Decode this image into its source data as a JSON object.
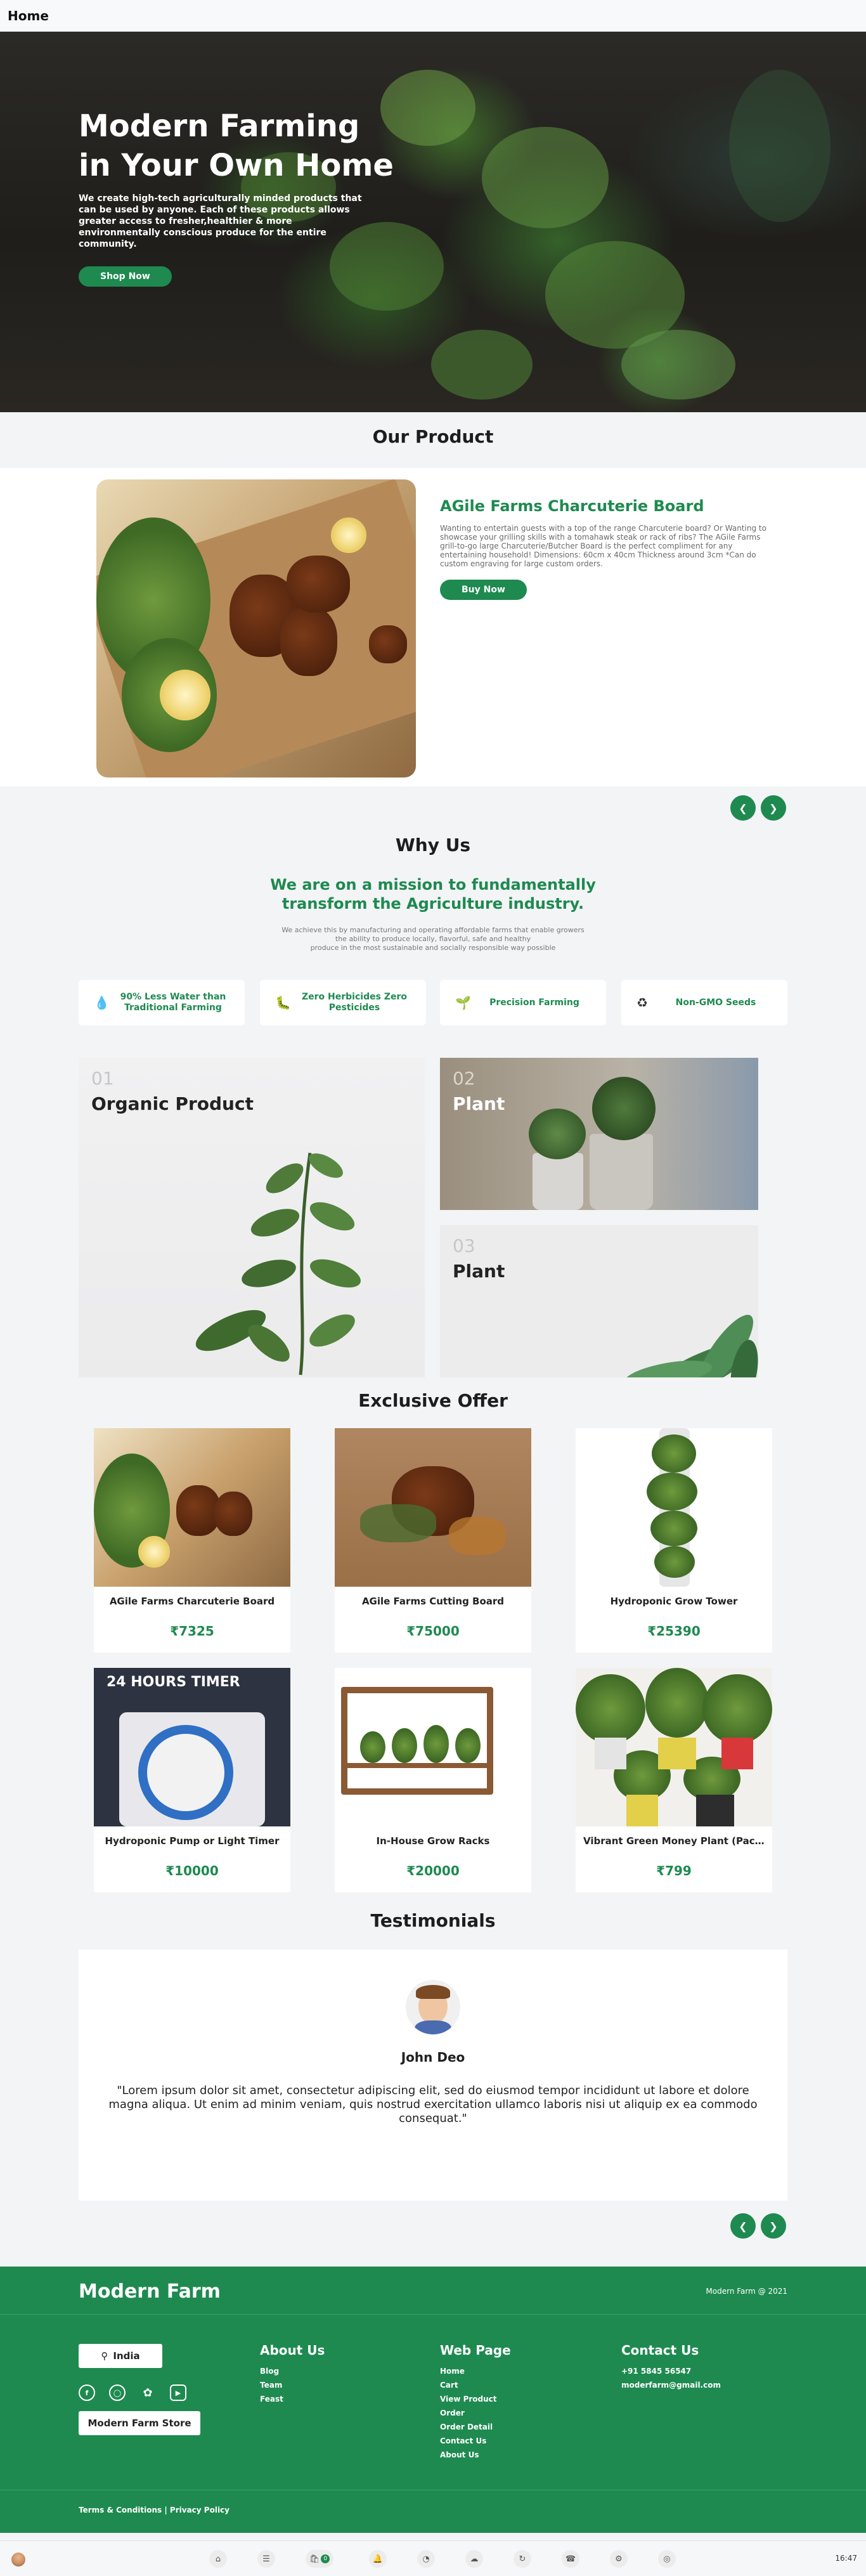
{
  "topbar": {
    "title": "Home"
  },
  "hero": {
    "title_line1": "Modern Farming",
    "title_line2": "in Your Own Home",
    "description": "We create high-tech agriculturally minded products that can be used by anyone. Each of these products allows greater access to fresher,healthier & more environmentally conscious produce for the entire community.",
    "button": "Shop Now"
  },
  "our_product": {
    "heading": "Our Product",
    "title": "AGile Farms Charcuterie Board",
    "description": "Wanting to entertain guests with a top of the range Charcuterie board? Or Wanting to showcase your grilling skills with a tomahawk steak or rack of ribs? The AGile Farms grill-to-go large Charcuterie/Butcher Board is the perfect compliment for any entertaining household! Dimensions: 60cm x 40cm Thickness around 3cm *Can do custom engraving for large custom orders.",
    "button": "Buy Now",
    "prev_icon": "chevron-left",
    "next_icon": "chevron-right"
  },
  "why_us": {
    "heading": "Why Us",
    "mission_line1": "We are on a mission to fundamentally",
    "mission_line2": "transform the Agriculture industry.",
    "sub_line1": "We achieve this by manufacturing and operating affordable farms that enable growers",
    "sub_line2": "the ability to produce locally, flavorful, safe and healthy",
    "sub_line3": "produce in the most sustainable and socially responsible way possible",
    "features": [
      {
        "icon": "water-drop-icon",
        "label": "90% Less Water than Traditional Farming"
      },
      {
        "icon": "bug-icon",
        "label": "Zero Herbicides Zero Pesticides"
      },
      {
        "icon": "plant-icon",
        "label": "Precision Farming"
      },
      {
        "icon": "recycle-icon",
        "label": "Non-GMO Seeds"
      }
    ],
    "tiles": [
      {
        "num": "01",
        "title": "Organic Product"
      },
      {
        "num": "02",
        "title": "Plant"
      },
      {
        "num": "03",
        "title": "Plant"
      }
    ]
  },
  "exclusive_offer": {
    "heading": "Exclusive Offer",
    "items": [
      {
        "name": "AGile Farms Charcuterie Board",
        "price": "₹7325"
      },
      {
        "name": "AGile Farms Cutting Board",
        "price": "₹75000"
      },
      {
        "name": "Hydroponic Grow Tower",
        "price": "₹25390"
      },
      {
        "name": "Hydroponic Pump or Light Timer",
        "price": "₹10000"
      },
      {
        "name": "In-House Grow Racks",
        "price": "₹20000"
      },
      {
        "name": "Vibrant Green Money Plant (Pack of 3)",
        "price": "₹799"
      }
    ],
    "timer_text": "24 HOURS TIMER"
  },
  "testimonials": {
    "heading": "Testimonials",
    "name": "John Deo",
    "quote": "\"Lorem ipsum dolor sit amet, consectetur adipiscing elit, sed do eiusmod tempor incididunt ut labore et dolore magna aliqua. Ut enim ad minim veniam, quis nostrud exercitation ullamco laboris nisi ut aliquip ex ea commodo consequat.\""
  },
  "footer": {
    "brand": "Modern Farm",
    "copyright": "Modern Farm @ 2021",
    "country": "India",
    "store_button": "Modern Farm Store",
    "social_icons": [
      "facebook-icon",
      "instagram-icon",
      "twitter-icon",
      "youtube-icon"
    ],
    "about": {
      "heading": "About Us",
      "items": [
        "Blog",
        "Team",
        "Feast"
      ]
    },
    "webpage": {
      "heading": "Web Page",
      "items": [
        "Home",
        "Cart",
        "View Product",
        "Order",
        "Order Detail",
        "Contact Us",
        "About Us"
      ]
    },
    "contact": {
      "heading": "Contact Us",
      "items": [
        "+91 5845 56547",
        "moderfarm@gmail.com"
      ]
    },
    "terms": "Terms & Conditions | Privacy Policy"
  },
  "taskbar": {
    "badge": "0",
    "time": "16:47"
  },
  "colors": {
    "brand_green": "#1e8a50",
    "page_bg": "#f3f4f6"
  }
}
